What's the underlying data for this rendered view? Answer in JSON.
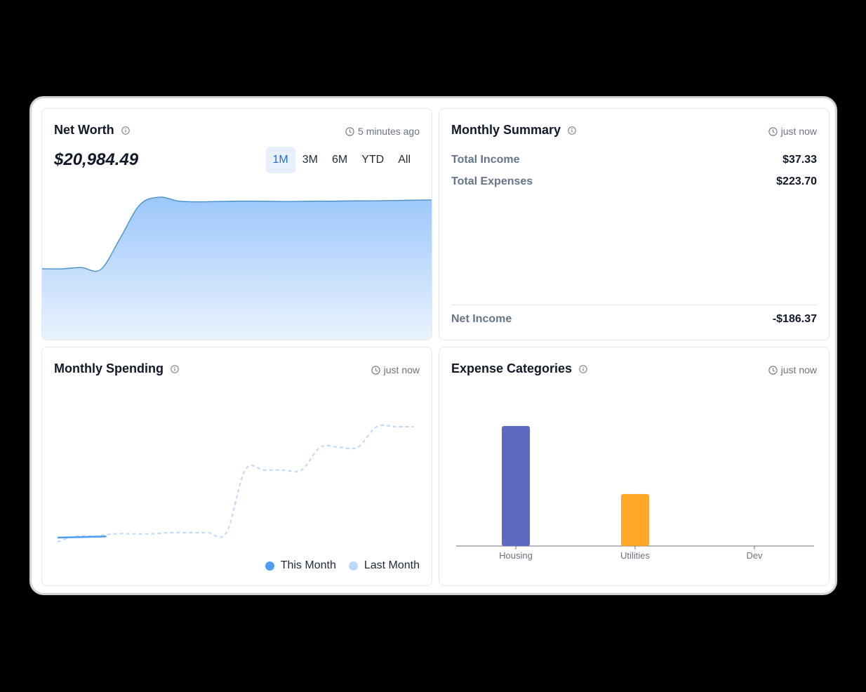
{
  "net_worth": {
    "title": "Net Worth",
    "updated": "5 minutes ago",
    "value": "$20,984.49",
    "ranges": [
      "1M",
      "3M",
      "6M",
      "YTD",
      "All"
    ],
    "active_range": "1M"
  },
  "summary": {
    "title": "Monthly Summary",
    "updated": "just now",
    "income_label": "Total Income",
    "income_value": "$37.33",
    "expenses_label": "Total Expenses",
    "expenses_value": "$223.70",
    "net_label": "Net Income",
    "net_value": "-$186.37"
  },
  "spending": {
    "title": "Monthly Spending",
    "updated": "just now",
    "legend_this": "This Month",
    "legend_last": "Last Month",
    "colors": {
      "this_month": "#4f9cf0",
      "last_month": "#bcd8f7"
    }
  },
  "categories": {
    "title": "Expense Categories",
    "updated": "just now",
    "colors": {
      "Housing": "#5c6bc0",
      "Utilities": "#ffa726",
      "Dev": "#4f9cf0"
    }
  },
  "chart_data": [
    {
      "type": "area",
      "title": "Net Worth",
      "note": "no axes shown; relative shape only",
      "x": [
        0,
        1,
        2,
        3,
        4,
        5,
        6,
        7,
        8,
        9,
        10,
        11,
        12,
        13,
        14,
        15,
        16,
        17,
        18,
        19,
        20
      ],
      "values": [
        0.2,
        0.2,
        0.6,
        0.0,
        9.5,
        19.5,
        21.8,
        20.6,
        20.4,
        20.5,
        20.6,
        20.6,
        20.5,
        20.5,
        20.6,
        20.6,
        20.7,
        20.7,
        20.8,
        20.9,
        20.98
      ]
    },
    {
      "type": "line",
      "title": "Monthly Spending",
      "series": [
        {
          "name": "This Month",
          "values": [
            0.0,
            0.5,
            1.0
          ]
        },
        {
          "name": "Last Month",
          "values": [
            0,
            5,
            5,
            7,
            7,
            7,
            8,
            8,
            8,
            8,
            63,
            63,
            63,
            63,
            83,
            83,
            83,
            101,
            101,
            101
          ]
        }
      ]
    },
    {
      "type": "bar",
      "title": "Expense Categories",
      "categories": [
        "Housing",
        "Utilities",
        "Dev"
      ],
      "values": [
        150,
        65,
        0
      ]
    }
  ]
}
